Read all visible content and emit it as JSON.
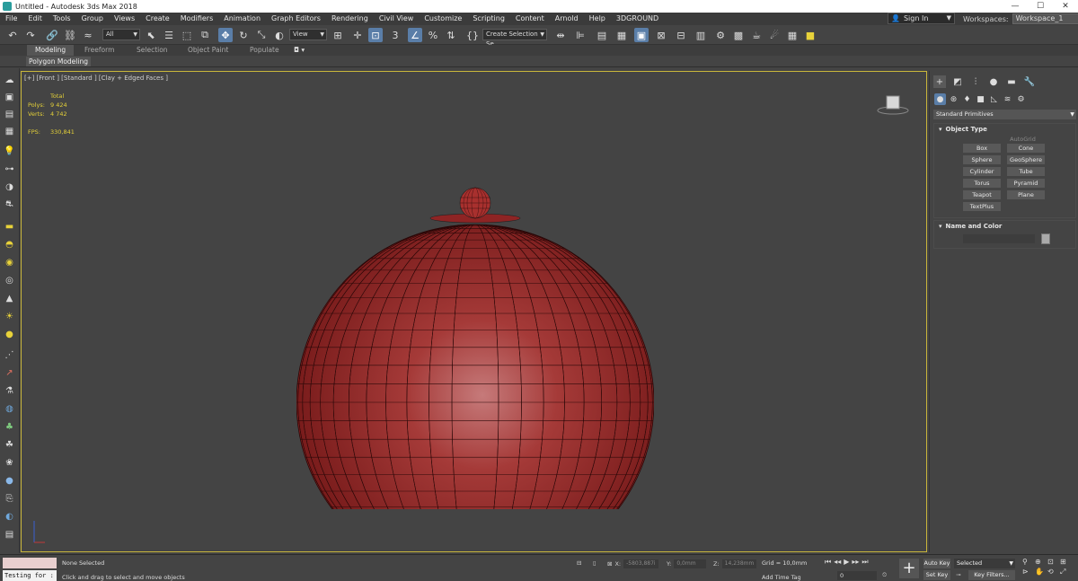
{
  "window": {
    "title": "Untitled - Autodesk 3ds Max 2018",
    "min": "—",
    "max": "☐",
    "close": "✕"
  },
  "menu": [
    "File",
    "Edit",
    "Tools",
    "Group",
    "Views",
    "Create",
    "Modifiers",
    "Animation",
    "Graph Editors",
    "Rendering",
    "Civil View",
    "Customize",
    "Scripting",
    "Content",
    "Arnold",
    "Help",
    "3DGROUND"
  ],
  "account": {
    "signin": "Sign In",
    "workspaces_label": "Workspaces:",
    "workspace": "Workspace_1"
  },
  "toolbar": {
    "filter": "All",
    "refcoord": "View",
    "selection_set": "Create Selection Se",
    "snap_label": "3"
  },
  "ribbon": {
    "tabs": [
      "Modeling",
      "Freeform",
      "Selection",
      "Object Paint",
      "Populate"
    ],
    "active": "Modeling",
    "sub": "Polygon Modeling"
  },
  "viewport": {
    "label": "[+] [Front ] [Standard ] [Clay + Edged Faces ]",
    "stats": {
      "total": "Total",
      "polys_label": "Polys:",
      "polys": "9 424",
      "verts_label": "Verts:",
      "verts": "4 742",
      "fps_label": "FPS:",
      "fps": "330,841"
    },
    "colors": {
      "border": "#c9b63b",
      "object": "#9b2a2a",
      "stats": "#e4d038"
    }
  },
  "command_panel": {
    "dropdown": "Standard Primitives",
    "object_type": {
      "title": "Object Type",
      "autogrid": "AutoGrid",
      "buttons": [
        "Box",
        "Cone",
        "Sphere",
        "GeoSphere",
        "Cylinder",
        "Tube",
        "Torus",
        "Pyramid",
        "Teapot",
        "Plane",
        "TextPlus"
      ]
    },
    "name_color": {
      "title": "Name and Color"
    }
  },
  "status": {
    "testing": "Testing for :",
    "selection": "None Selected",
    "prompt": "Click and drag to select and move objects",
    "x_label": "X:",
    "x": "-5803,887i",
    "y_label": "Y:",
    "y": "0,0mm",
    "z_label": "Z:",
    "z": "14,238mm",
    "grid": "Grid = 10,0mm",
    "add_time_tag": "Add Time Tag",
    "frame": "0",
    "auto_key": "Auto Key",
    "set_key": "Set Key",
    "selected": "Selected",
    "key_filters": "Key Filters..."
  }
}
